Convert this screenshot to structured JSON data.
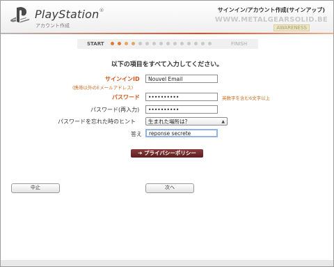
{
  "header": {
    "brand": "PlayStation",
    "brand_mark": "®",
    "brand_subtitle": "アカウント作成",
    "page_title": "サインイン/アカウント作成(サインアップ)",
    "watermark": "WWW.METALGEARSOLID.BE",
    "watermark_tag": "AWARENESS"
  },
  "progress": {
    "start_label": "START",
    "finish_label": "FINISH",
    "dot_colors": [
      "#e07a2f",
      "#e07a2f",
      "#e8a55f",
      "#e8a55f",
      "#c8c8c8",
      "#c8c8c8",
      "#c8c8c8",
      "#c8c8c8",
      "#c8c8c8",
      "#c8c8c8",
      "#c8c8c8",
      "#c8c8c8",
      "#c8c8c8",
      "#c8c8c8",
      "#c8c8c8"
    ]
  },
  "form": {
    "instruction": "以下の項目をすべて入力してください。",
    "signin_id_label": "サインインID",
    "signin_id_sublabel": "(携帯以外のEメールアドレス)",
    "signin_id_value": "Nouvel Email",
    "password_label": "パスワード",
    "password_value": "••••••••••",
    "password_hint": "英数字を含む6文字以上",
    "password_confirm_label": "パスワード(再入力)",
    "password_confirm_value": "••••••••••",
    "hint_label": "パスワードを忘れた時のヒント",
    "hint_selected": "生まれた場所は？",
    "answer_label": "答え",
    "answer_value": "reponse secrete",
    "privacy_button": "➔ プライバシーポリシー"
  },
  "navigation": {
    "cancel": "中止",
    "next": "次へ"
  },
  "colors": {
    "accent_orange": "#d4531a",
    "privacy_button": "#6e2a2a"
  }
}
